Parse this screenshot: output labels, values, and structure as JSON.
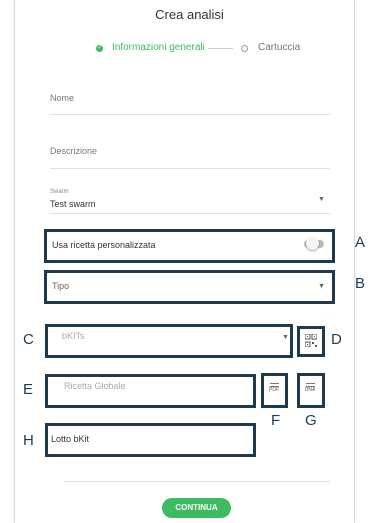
{
  "header": {
    "title": "Crea analisi"
  },
  "steps": [
    {
      "label": "Informazioni generali",
      "state": "done"
    },
    {
      "label": "Cartuccia",
      "state": "todo"
    }
  ],
  "form": {
    "nome_label": "Nome",
    "descrizione_label": "Descrizione",
    "swarm_label": "Swarm",
    "swarm_value": "Test swarm",
    "ricetta_label": "Usa ricetta personalizzata",
    "ricetta_toggle_on": false,
    "tipo_placeholder": "Tipo",
    "bkits_placeholder": "bKITs",
    "ricetta_globale_placeholder": "Ricetta Globale",
    "lotto_label": "Lotto bKit",
    "pdf_icon_text": "PDF",
    "dna_icon_text": "DNA"
  },
  "annotations": {
    "A": "A",
    "B": "B",
    "C": "C",
    "D": "D",
    "E": "E",
    "F": "F",
    "G": "G",
    "H": "H"
  },
  "actions": {
    "continue_label": "CONTINUA"
  },
  "colors": {
    "accent": "#3dbb61",
    "highlight": "#1f3a4f"
  }
}
